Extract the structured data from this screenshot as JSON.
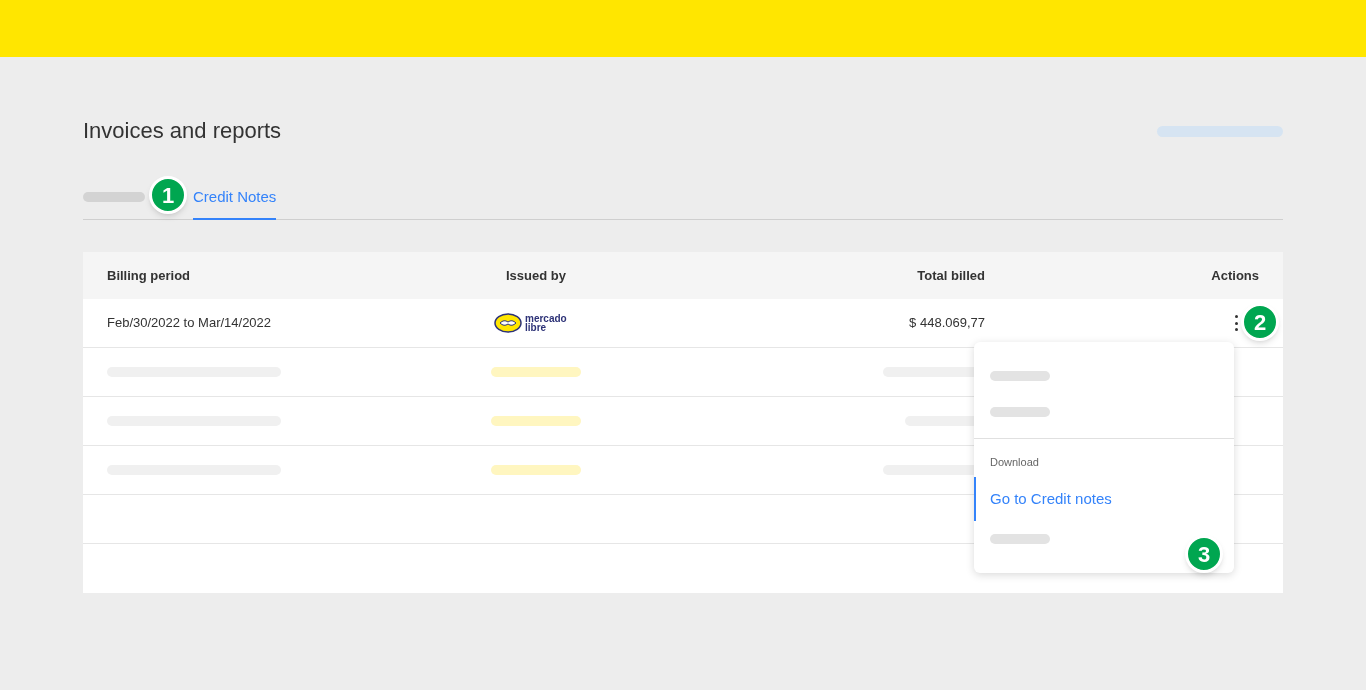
{
  "page": {
    "title": "Invoices and reports"
  },
  "tabs": [
    {
      "kind": "skeleton",
      "selected": false
    },
    {
      "kind": "text",
      "label": "Credit Notes",
      "selected": true
    }
  ],
  "table": {
    "columns": [
      "Billing period",
      "Issued by",
      "Total billed",
      "Actions"
    ],
    "rows": [
      {
        "kind": "data",
        "billing_period": "Feb/30/2022 to Mar/14/2022",
        "issued_by": [
          "mercado",
          "libre"
        ],
        "total_billed": "$ 448.069,77"
      },
      {
        "kind": "skeleton"
      },
      {
        "kind": "skeleton"
      },
      {
        "kind": "skeleton"
      },
      {
        "kind": "empty"
      },
      {
        "kind": "empty"
      }
    ]
  },
  "menu": {
    "items": [
      {
        "kind": "skeleton"
      },
      {
        "kind": "skeleton"
      },
      {
        "kind": "divider"
      },
      {
        "kind": "heading",
        "label": "Download"
      },
      {
        "kind": "link",
        "label": "Go to Credit notes",
        "selected": true
      },
      {
        "kind": "skeleton"
      }
    ]
  },
  "markers": [
    "1",
    "2",
    "3"
  ]
}
